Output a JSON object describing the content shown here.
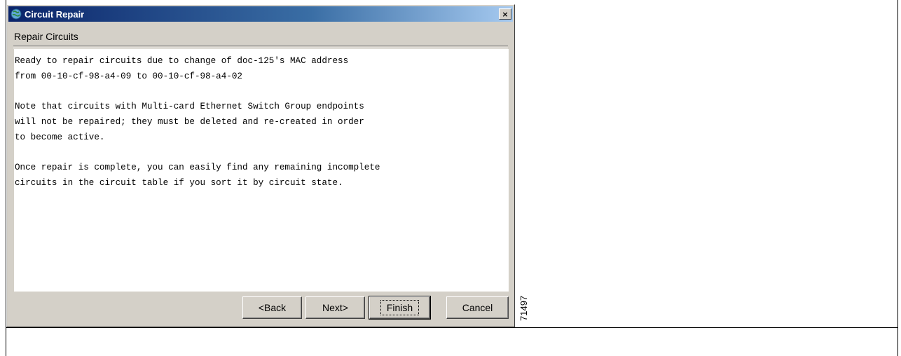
{
  "window": {
    "title": "Circuit Repair",
    "app_icon": "globe-icon",
    "close_symbol": "×"
  },
  "page": {
    "heading": "Repair Circuits"
  },
  "message": {
    "lines": [
      "Ready to repair circuits due to change of doc-125's MAC address",
      "from 00-10-cf-98-a4-09 to 00-10-cf-98-a4-02",
      "",
      "Note that circuits with Multi-card Ethernet Switch Group endpoints",
      "will not be repaired; they must be deleted and re-created in order",
      "to become active.",
      "",
      "Once repair is complete, you can easily find any remaining incomplete",
      "circuits in the circuit table if you sort it by circuit state."
    ]
  },
  "buttons": {
    "back": "<Back",
    "next": "Next>",
    "finish": "Finish",
    "cancel": "Cancel"
  },
  "figure_id": "71497",
  "colors": {
    "title_bar_start": "#0a246a",
    "title_bar_end": "#a6caf0",
    "dialog_face": "#d4d0c8"
  }
}
